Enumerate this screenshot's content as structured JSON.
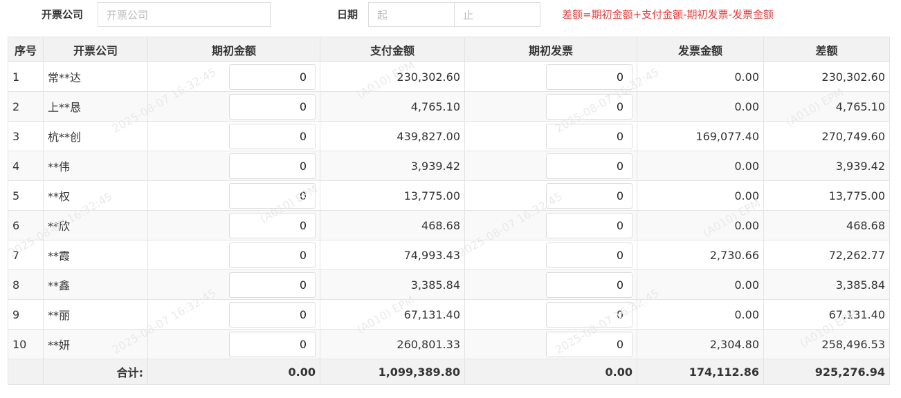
{
  "filters": {
    "company_label": "开票公司",
    "company_placeholder": "开票公司",
    "date_label": "日期",
    "date_start_placeholder": "起",
    "date_end_placeholder": "止",
    "formula": "差额=期初金额+支付金额-期初发票-发票金额"
  },
  "table": {
    "headers": [
      "序号",
      "开票公司",
      "期初金额",
      "支付金额",
      "期初发票",
      "发票金额",
      "差额"
    ],
    "rows": [
      {
        "idx": "1",
        "company": "常**达",
        "opening_amount": "0",
        "paid_amount": "230,302.60",
        "opening_invoice": "0",
        "invoice_amount": "0.00",
        "difference": "230,302.60"
      },
      {
        "idx": "2",
        "company": "上**恳",
        "opening_amount": "0",
        "paid_amount": "4,765.10",
        "opening_invoice": "0",
        "invoice_amount": "0.00",
        "difference": "4,765.10"
      },
      {
        "idx": "3",
        "company": "杭**创",
        "opening_amount": "0",
        "paid_amount": "439,827.00",
        "opening_invoice": "0",
        "invoice_amount": "169,077.40",
        "difference": "270,749.60"
      },
      {
        "idx": "4",
        "company": "**伟",
        "opening_amount": "0",
        "paid_amount": "3,939.42",
        "opening_invoice": "0",
        "invoice_amount": "0.00",
        "difference": "3,939.42"
      },
      {
        "idx": "5",
        "company": "**权",
        "opening_amount": "0",
        "paid_amount": "13,775.00",
        "opening_invoice": "0",
        "invoice_amount": "0.00",
        "difference": "13,775.00"
      },
      {
        "idx": "6",
        "company": "**欣",
        "opening_amount": "0",
        "paid_amount": "468.68",
        "opening_invoice": "0",
        "invoice_amount": "0.00",
        "difference": "468.68"
      },
      {
        "idx": "7",
        "company": "**霞",
        "opening_amount": "0",
        "paid_amount": "74,993.43",
        "opening_invoice": "0",
        "invoice_amount": "2,730.66",
        "difference": "72,262.77"
      },
      {
        "idx": "8",
        "company": "**鑫",
        "opening_amount": "0",
        "paid_amount": "3,385.84",
        "opening_invoice": "0",
        "invoice_amount": "0.00",
        "difference": "3,385.84"
      },
      {
        "idx": "9",
        "company": "**丽",
        "opening_amount": "0",
        "paid_amount": "67,131.40",
        "opening_invoice": "0",
        "invoice_amount": "0.00",
        "difference": "67,131.40"
      },
      {
        "idx": "10",
        "company": "**妍",
        "opening_amount": "0",
        "paid_amount": "260,801.33",
        "opening_invoice": "0",
        "invoice_amount": "2,304.80",
        "difference": "258,496.53"
      }
    ],
    "totals": {
      "label": "合计:",
      "opening_amount": "0.00",
      "paid_amount": "1,099,389.80",
      "opening_invoice": "0.00",
      "invoice_amount": "174,112.86",
      "difference": "925,276.94"
    }
  },
  "watermark": {
    "lines": [
      "2025-08-07 16:32:45",
      "(A010) EPM"
    ],
    "color": "#e8e8e8"
  }
}
